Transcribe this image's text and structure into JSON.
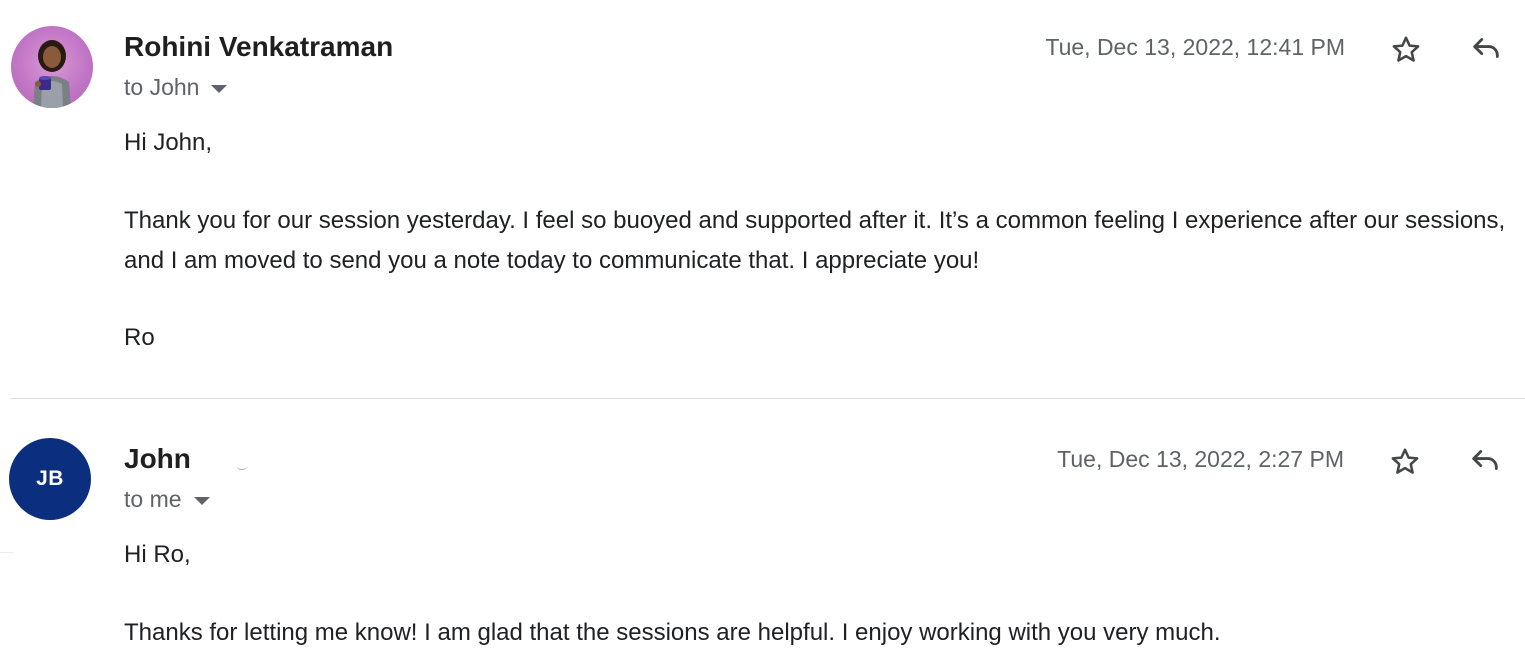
{
  "messages": [
    {
      "sender": "Rohini Venkatraman",
      "recipient": "to John",
      "timestamp": "Tue, Dec 13, 2022, 12:41 PM",
      "avatar": {
        "type": "photo",
        "color": "#c276c6"
      },
      "body": {
        "greeting": "Hi John,",
        "paragraph": "Thank you for our session yesterday. I feel so buoyed and supported after it. It’s a common feeling I experience after our sessions, and I am moved to send you a note today to communicate that. I appreciate you!",
        "signature": "Ro"
      },
      "icons": {
        "star": "star-icon",
        "reply": "reply-icon"
      }
    },
    {
      "sender": "John",
      "recipient": "to me",
      "timestamp": "Tue, Dec 13, 2022, 2:27 PM",
      "avatar": {
        "type": "initials",
        "initials": "JB",
        "color": "#0b2f7e"
      },
      "body": {
        "greeting": "Hi Ro,",
        "paragraph": "Thanks for letting me know! I am glad that the sessions are helpful. I enjoy working with you very much."
      },
      "icons": {
        "star": "star-icon",
        "reply": "reply-icon"
      }
    }
  ]
}
